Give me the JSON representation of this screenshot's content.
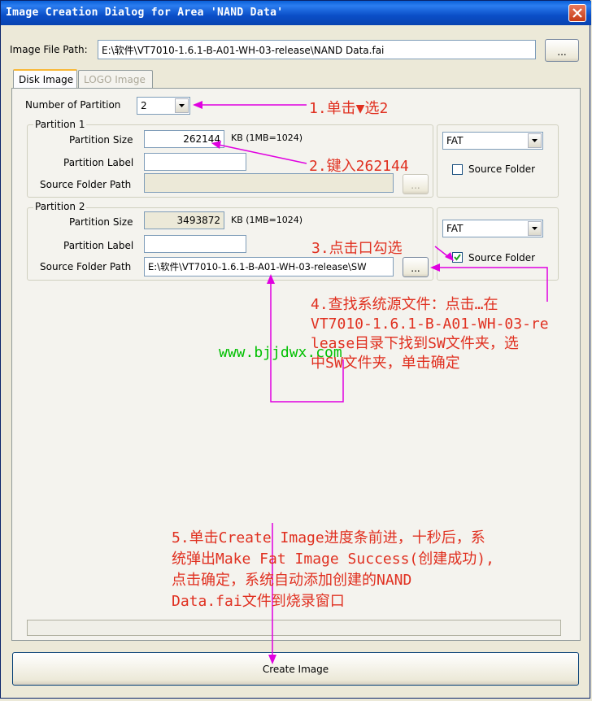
{
  "window": {
    "title": "Image Creation Dialog for Area 'NAND Data'"
  },
  "image_path": {
    "label": "Image File Path:",
    "value": "E:\\软件\\VT7010-1.6.1-B-A01-WH-03-release\\NAND Data.fai",
    "browse_label": "..."
  },
  "tabs": [
    {
      "label": "Disk Image",
      "active": true
    },
    {
      "label": "LOGO Image",
      "active": false
    }
  ],
  "partition_count": {
    "label": "Number of Partition",
    "value": "2"
  },
  "partition1": {
    "legend": "Partition 1",
    "size_label": "Partition Size",
    "size_value": "262144",
    "size_unit": "KB (1MB=1024)",
    "label_label": "Partition Label",
    "label_value": "",
    "folder_label": "Source Folder Path",
    "folder_value": "",
    "browse_label": "...",
    "fs_value": "FAT",
    "source_folder_label": "Source Folder",
    "source_folder_checked": false
  },
  "partition2": {
    "legend": "Partition 2",
    "size_label": "Partition Size",
    "size_value": "3493872",
    "size_unit": "KB (1MB=1024)",
    "label_label": "Partition Label",
    "label_value": "",
    "folder_label": "Source Folder Path",
    "folder_value": "E:\\软件\\VT7010-1.6.1-B-A01-WH-03-release\\SW",
    "browse_label": "...",
    "fs_value": "FAT",
    "source_folder_label": "Source Folder",
    "source_folder_checked": true
  },
  "progress": {
    "fraction": 0
  },
  "create_button": {
    "label": "Create Image"
  },
  "annotations": {
    "step1": "1.单击▼选2",
    "step2": "2.键入262144",
    "step3": "3.点击口勾选",
    "step4": "4.查找系统源文件：点击…在\nVT7010-1.6.1-B-A01-WH-03-re\nlease目录下找到SW文件夹，选\n中SW文件夹，单击确定",
    "step5": "5.单击Create Image进度条前进，十秒后，系\n统弹出Make Fat Image Success(创建成功),\n点击确定，系统自动添加创建的NAND\nData.fai文件到烧录窗口",
    "watermark": "www.bjjdwx.com"
  },
  "colors": {
    "annotation_text": "#e03020",
    "arrow": "#e000e0",
    "watermark": "#00c000",
    "titlebar": "#0b4fc8"
  }
}
